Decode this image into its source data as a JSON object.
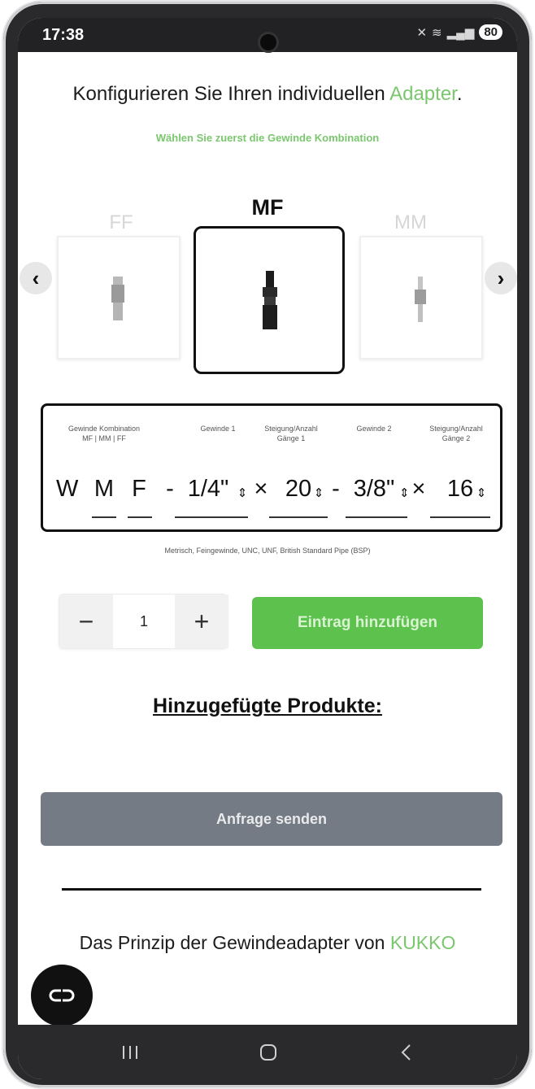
{
  "status_bar": {
    "time": "17:38",
    "battery": "80"
  },
  "page": {
    "title_prefix": "Konfigurieren Sie Ihren individuellen ",
    "title_accent": "Adapter",
    "title_suffix": ".",
    "subtitle": "Wählen Sie zuerst die Gewinde Kombination"
  },
  "carousel": {
    "options": [
      {
        "label": "FF",
        "selected": false
      },
      {
        "label": "MF",
        "selected": true
      },
      {
        "label": "MM",
        "selected": false
      }
    ],
    "prev_icon": "chevron-left-icon",
    "next_icon": "chevron-right-icon"
  },
  "configurator": {
    "headers": {
      "combination_line1": "Gewinde Kombination",
      "combination_line2": "MF | MM | FF",
      "thread1": "Gewinde 1",
      "pitch1_line1": "Steigung/Anzahl",
      "pitch1_line2": "Gänge 1",
      "thread2": "Gewinde 2",
      "pitch2_line1": "Steigung/Anzahl",
      "pitch2_line2": "Gänge 2"
    },
    "code": {
      "prefix": "W",
      "first_gender": "M",
      "second_gender": "F",
      "dash1": "-",
      "thread1": "1/4\"",
      "times1": "×",
      "pitch1": "20",
      "dash2": "-",
      "thread2": "3/8\"",
      "times2": "×",
      "pitch2": "16"
    },
    "hint": "Metrisch, Feingewinde, UNC, UNF, British Standard Pipe (BSP)"
  },
  "quantity": {
    "minus": "−",
    "value": "1",
    "plus": "+"
  },
  "add_button": "Eintrag hinzufügen",
  "products_heading": "Hinzugefügte Produkte:",
  "send_button": "Anfrage senden",
  "footer": {
    "prefix": "Das Prinzip der Gewindeadapter von ",
    "accent": "KUKKO"
  },
  "colors": {
    "accent": "#7ac76e",
    "add_button": "#5cc24d",
    "send_button": "#747b84"
  }
}
